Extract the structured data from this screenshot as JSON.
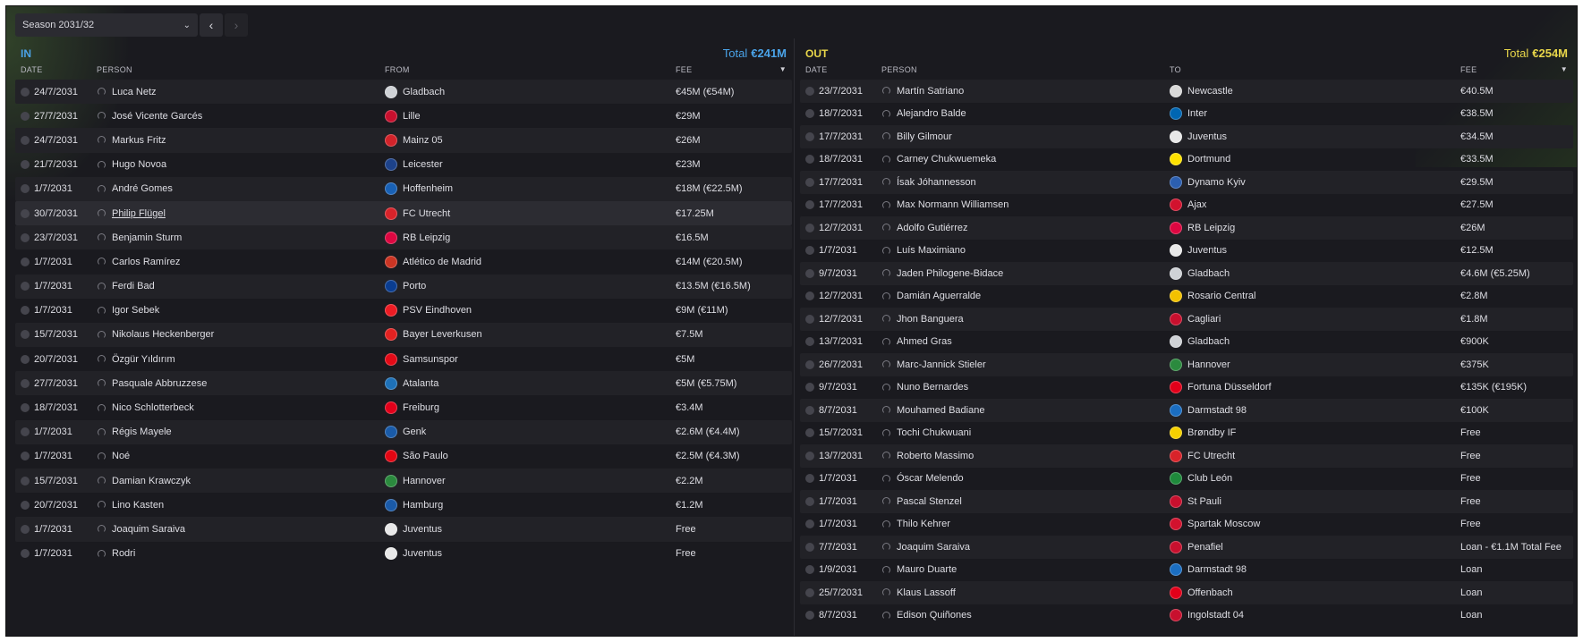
{
  "season": {
    "label": "Season 2031/32"
  },
  "colors": {
    "in_accent": "#4aa3e8",
    "out_accent": "#e8d64a"
  },
  "in": {
    "title": "IN",
    "total_label": "Total",
    "total_value": "€241M",
    "headers": {
      "date": "DATE",
      "person": "PERSON",
      "club": "FROM",
      "fee": "FEE"
    },
    "rows": [
      {
        "date": "24/7/2031",
        "person": "Luca Netz",
        "club": "Gladbach",
        "fee": "€45M (€54M)",
        "crest": "#cfd2d6"
      },
      {
        "date": "27/7/2031",
        "person": "José Vicente Garcés",
        "club": "Lille",
        "fee": "€29M",
        "crest": "#c8102e"
      },
      {
        "date": "24/7/2031",
        "person": "Markus Fritz",
        "club": "Mainz 05",
        "fee": "€26M",
        "crest": "#d2232a"
      },
      {
        "date": "21/7/2031",
        "person": "Hugo Novoa",
        "club": "Leicester",
        "fee": "€23M",
        "crest": "#1d428a"
      },
      {
        "date": "1/7/2031",
        "person": "André Gomes",
        "club": "Hoffenheim",
        "fee": "€18M (€22.5M)",
        "crest": "#1961b5"
      },
      {
        "date": "30/7/2031",
        "person": "Philip Flügel",
        "club": "FC Utrecht",
        "fee": "€17.25M",
        "crest": "#d8232a"
      },
      {
        "date": "23/7/2031",
        "person": "Benjamin Sturm",
        "club": "RB Leipzig",
        "fee": "€16.5M",
        "crest": "#dd0741"
      },
      {
        "date": "1/7/2031",
        "person": "Carlos Ramírez",
        "club": "Atlético de Madrid",
        "fee": "€14M (€20.5M)",
        "crest": "#cb3524"
      },
      {
        "date": "1/7/2031",
        "person": "Ferdi Bad",
        "club": "Porto",
        "fee": "€13.5M (€16.5M)",
        "crest": "#0a3d91"
      },
      {
        "date": "1/7/2031",
        "person": "Igor Sebek",
        "club": "PSV Eindhoven",
        "fee": "€9M (€11M)",
        "crest": "#ed1c24"
      },
      {
        "date": "15/7/2031",
        "person": "Nikolaus Heckenberger",
        "club": "Bayer Leverkusen",
        "fee": "€7.5M",
        "crest": "#e32221"
      },
      {
        "date": "20/7/2031",
        "person": "Özgür Yıldırım",
        "club": "Samsunspor",
        "fee": "€5M",
        "crest": "#e30a17"
      },
      {
        "date": "27/7/2031",
        "person": "Pasquale Abbruzzese",
        "club": "Atalanta",
        "fee": "€5M (€5.75M)",
        "crest": "#1e71b8"
      },
      {
        "date": "18/7/2031",
        "person": "Nico Schlotterbeck",
        "club": "Freiburg",
        "fee": "€3.4M",
        "crest": "#e2001a"
      },
      {
        "date": "1/7/2031",
        "person": "Régis Mayele",
        "club": "Genk",
        "fee": "€2.6M (€4.4M)",
        "crest": "#1a5ba8"
      },
      {
        "date": "1/7/2031",
        "person": "Noé",
        "club": "São Paulo",
        "fee": "€2.5M (€4.3M)",
        "crest": "#e30613"
      },
      {
        "date": "15/7/2031",
        "person": "Damian Krawczyk",
        "club": "Hannover",
        "fee": "€2.2M",
        "crest": "#2b8a3e"
      },
      {
        "date": "20/7/2031",
        "person": "Lino Kasten",
        "club": "Hamburg",
        "fee": "€1.2M",
        "crest": "#1a5aa8"
      },
      {
        "date": "1/7/2031",
        "person": "Joaquim Saraiva",
        "club": "Juventus",
        "fee": "Free",
        "crest": "#e8e8e8"
      },
      {
        "date": "1/7/2031",
        "person": "Rodri",
        "club": "Juventus",
        "fee": "Free",
        "crest": "#e8e8e8"
      }
    ]
  },
  "out": {
    "title": "OUT",
    "total_label": "Total",
    "total_value": "€254M",
    "headers": {
      "date": "DATE",
      "person": "PERSON",
      "club": "TO",
      "fee": "FEE"
    },
    "rows": [
      {
        "date": "23/7/2031",
        "person": "Martín Satriano",
        "club": "Newcastle",
        "fee": "€40.5M",
        "crest": "#d9d9d9"
      },
      {
        "date": "18/7/2031",
        "person": "Alejandro Balde",
        "club": "Inter",
        "fee": "€38.5M",
        "crest": "#0066b2"
      },
      {
        "date": "17/7/2031",
        "person": "Billy Gilmour",
        "club": "Juventus",
        "fee": "€34.5M",
        "crest": "#e8e8e8"
      },
      {
        "date": "18/7/2031",
        "person": "Carney Chukwuemeka",
        "club": "Dortmund",
        "fee": "€33.5M",
        "crest": "#fde100"
      },
      {
        "date": "17/7/2031",
        "person": "Ísak Jóhannesson",
        "club": "Dynamo Kyiv",
        "fee": "€29.5M",
        "crest": "#2c5fb0"
      },
      {
        "date": "17/7/2031",
        "person": "Max Normann Williamsen",
        "club": "Ajax",
        "fee": "€27.5M",
        "crest": "#d2122e"
      },
      {
        "date": "12/7/2031",
        "person": "Adolfo Gutiérrez",
        "club": "RB Leipzig",
        "fee": "€26M",
        "crest": "#dd0741"
      },
      {
        "date": "1/7/2031",
        "person": "Luís Maximiano",
        "club": "Juventus",
        "fee": "€12.5M",
        "crest": "#e8e8e8"
      },
      {
        "date": "9/7/2031",
        "person": "Jaden Philogene-Bidace",
        "club": "Gladbach",
        "fee": "€4.6M (€5.25M)",
        "crest": "#cfd2d6"
      },
      {
        "date": "12/7/2031",
        "person": "Damián Aguerralde",
        "club": "Rosario Central",
        "fee": "€2.8M",
        "crest": "#f2c100"
      },
      {
        "date": "12/7/2031",
        "person": "Jhon Banguera",
        "club": "Cagliari",
        "fee": "€1.8M",
        "crest": "#c8102e"
      },
      {
        "date": "13/7/2031",
        "person": "Ahmed Gras",
        "club": "Gladbach",
        "fee": "€900K",
        "crest": "#cfd2d6"
      },
      {
        "date": "26/7/2031",
        "person": "Marc-Jannick Stieler",
        "club": "Hannover",
        "fee": "€375K",
        "crest": "#2b8a3e"
      },
      {
        "date": "9/7/2031",
        "person": "Nuno Bernardes",
        "club": "Fortuna Düsseldorf",
        "fee": "€135K (€195K)",
        "crest": "#e2001a"
      },
      {
        "date": "8/7/2031",
        "person": "Mouhamed Badiane",
        "club": "Darmstadt 98",
        "fee": "€100K",
        "crest": "#1b6ec2"
      },
      {
        "date": "15/7/2031",
        "person": "Tochi Chukwuani",
        "club": "Brøndby IF",
        "fee": "Free",
        "crest": "#f5d000"
      },
      {
        "date": "13/7/2031",
        "person": "Roberto Massimo",
        "club": "FC Utrecht",
        "fee": "Free",
        "crest": "#d8232a"
      },
      {
        "date": "1/7/2031",
        "person": "Óscar Melendo",
        "club": "Club León",
        "fee": "Free",
        "crest": "#1f8a3c"
      },
      {
        "date": "1/7/2031",
        "person": "Pascal Stenzel",
        "club": "St Pauli",
        "fee": "Free",
        "crest": "#c8102e"
      },
      {
        "date": "1/7/2031",
        "person": "Thilo Kehrer",
        "club": "Spartak Moscow",
        "fee": "Free",
        "crest": "#d2122e"
      },
      {
        "date": "7/7/2031",
        "person": "Joaquim Saraiva",
        "club": "Penafiel",
        "fee": "Loan - €1.1M Total Fee",
        "crest": "#c8102e"
      },
      {
        "date": "1/9/2031",
        "person": "Mauro Duarte",
        "club": "Darmstadt 98",
        "fee": "Loan",
        "crest": "#1b6ec2"
      },
      {
        "date": "25/7/2031",
        "person": "Klaus Lassoff",
        "club": "Offenbach",
        "fee": "Loan",
        "crest": "#e2001a"
      },
      {
        "date": "8/7/2031",
        "person": "Edison Quiñones",
        "club": "Ingolstadt 04",
        "fee": "Loan",
        "crest": "#c8102e"
      }
    ]
  }
}
